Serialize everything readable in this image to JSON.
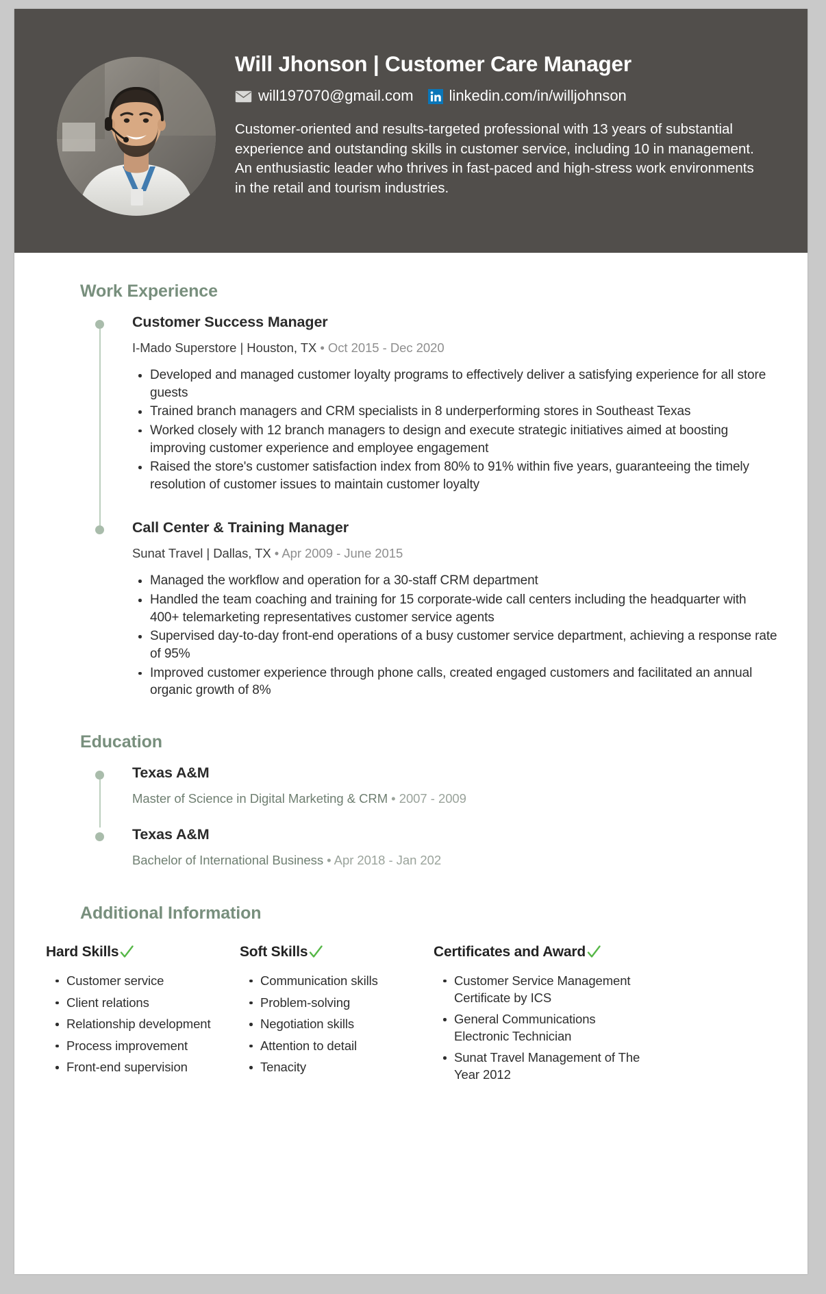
{
  "theme": {
    "page_background": "#c9c9c9",
    "header_background": "#514e4b",
    "accent_green": "#788f7a",
    "timeline_dot": "#a9bcab",
    "check_green": "#56b747",
    "linkedin_blue": "#0a76b8"
  },
  "header": {
    "name": "Will Jhonson ",
    "separator": "| ",
    "role": "Customer Care Manager",
    "full_title": "Will Jhonson  | Customer Care Manager",
    "email_icon": "envelope-icon",
    "email": "will197070@gmail.com",
    "linkedin_icon": "linkedin-icon",
    "linkedin": "linkedin.com/in/willjohnson",
    "photo_alt": "headshot-photo",
    "summary": "Customer-oriented and results-targeted professional with 13 years of substantial experience and outstanding skills in customer service, including 10 in management. An enthusiastic leader who thrives in fast-paced and high-stress work environments in the retail and tourism industries."
  },
  "sections": {
    "work": {
      "title": "Work Experience",
      "entries": [
        {
          "title": "Customer Success Manager",
          "company": "I-Mado Superstore | Houston, TX",
          "separator": "•",
          "dates": "Oct 2015 - Dec 2020",
          "bullets": [
            "Developed and managed customer loyalty programs to effectively deliver a satisfying experience for all store guests",
            "Trained branch managers and CRM specialists in 8 underperforming stores in Southeast Texas",
            "Worked closely with 12 branch managers to design and execute strategic initiatives aimed at boosting improving customer experience and employee engagement",
            "Raised the store's customer satisfaction index from 80% to 91% within five years, guaranteeing the timely resolution of customer issues to maintain customer loyalty"
          ]
        },
        {
          "title": "Call Center & Training Manager",
          "company": "Sunat Travel | Dallas, TX",
          "separator": "•",
          "dates": "Apr 2009  - June 2015",
          "bullets": [
            "Managed the workflow and operation for a 30-staff CRM department",
            "Handled the team coaching and training for 15 corporate-wide call centers including the headquarter with 400+ telemarketing representatives customer service agents",
            "Supervised day-to-day front-end operations of a busy customer service department, achieving a response rate of 95%",
            "Improved customer experience through phone calls, created engaged customers and facilitated an annual organic growth of 8%"
          ]
        }
      ]
    },
    "education": {
      "title": "Education",
      "entries": [
        {
          "school": "Texas A&M",
          "degree": "Master of Science in Digital Marketing & CRM",
          "separator": "•",
          "dates": "2007 - 2009"
        },
        {
          "school": "Texas A&M",
          "degree": "Bachelor of International Business",
          "separator": "•",
          "dates": "Apr 2018 - Jan 202"
        }
      ]
    },
    "additional": {
      "title": "Additional Information",
      "columns": [
        {
          "heading": "Hard Skills",
          "check_icon": "check-icon",
          "items": [
            "Customer service",
            "Client relations",
            "Relationship development",
            "Process improvement",
            "Front-end supervision"
          ]
        },
        {
          "heading": "Soft Skills",
          "check_icon": "check-icon",
          "items": [
            "Communication skills",
            "Problem-solving",
            "Negotiation skills",
            "Attention to detail",
            "Tenacity"
          ]
        },
        {
          "heading": "Certificates and Award",
          "check_icon": "check-icon",
          "items": [
            "Customer Service Management Certificate by ICS",
            "General Communications Electronic Technician",
            "Sunat Travel Management of The Year 2012"
          ]
        }
      ]
    }
  }
}
